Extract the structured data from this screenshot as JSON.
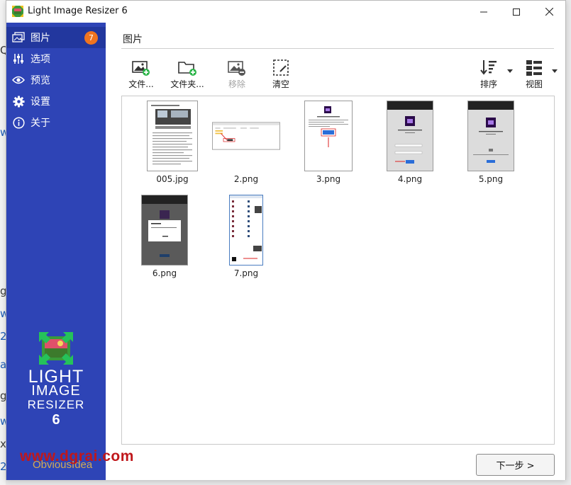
{
  "background": {
    "left_fragments": [
      "g",
      "w",
      "g",
      "w",
      "2",
      "a",
      "g",
      "w",
      "x",
      "2"
    ]
  },
  "window": {
    "title": "Light Image Resizer 6",
    "controls": {
      "minimize": "—",
      "maximize": "☐",
      "close": "✕"
    }
  },
  "sidebar": {
    "items": [
      {
        "label": "图片",
        "icon": "pictures-icon",
        "active": true,
        "badge": "7"
      },
      {
        "label": "选项",
        "icon": "sliders-icon"
      },
      {
        "label": "预览",
        "icon": "eye-icon"
      },
      {
        "label": "设置",
        "icon": "gear-icon"
      },
      {
        "label": "关于",
        "icon": "info-icon"
      }
    ],
    "brand": {
      "line1": "LIGHT",
      "line2": "IMAGE",
      "line3": "RESIZER",
      "line4": "6"
    }
  },
  "main": {
    "section_title": "图片",
    "toolbar": {
      "add_files": "文件...",
      "add_folder": "文件夹...",
      "remove": "移除",
      "clear": "清空",
      "sort": "排序",
      "view": "视图"
    },
    "images": [
      {
        "name": "005.jpg"
      },
      {
        "name": "2.png"
      },
      {
        "name": "3.png"
      },
      {
        "name": "4.png"
      },
      {
        "name": "5.png"
      },
      {
        "name": "6.png"
      },
      {
        "name": "7.png"
      }
    ],
    "next_button": "下一步 >"
  },
  "watermark": {
    "text": "www.dgrai.com",
    "sub": "ObviousIdea"
  },
  "colors": {
    "sidebar": "#2e44b6",
    "sidebar_active": "#22379e",
    "badge": "#f0741f",
    "add_green": "#2db54a"
  }
}
